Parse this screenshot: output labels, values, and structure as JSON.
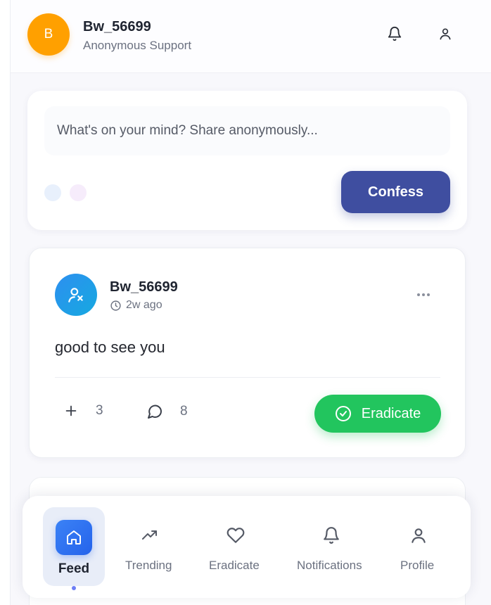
{
  "header": {
    "avatar_initial": "B",
    "username": "Bw_56699",
    "subtitle": "Anonymous Support",
    "icons": [
      "bell-icon",
      "user-icon"
    ]
  },
  "compose": {
    "placeholder": "What's on your mind? Share anonymously...",
    "submit_label": "Confess"
  },
  "posts": [
    {
      "author": "Bw_56699",
      "time": "2w ago",
      "text": "good to see you",
      "support_count": "3",
      "comment_count": "8",
      "eradicate_label": "Eradicate"
    }
  ],
  "nav": {
    "items": [
      {
        "label": "Feed",
        "icon": "home-icon",
        "active": true
      },
      {
        "label": "Trending",
        "icon": "trending-up-icon"
      },
      {
        "label": "Eradicate",
        "icon": "heart-icon"
      },
      {
        "label": "Notifications",
        "icon": "bell-icon"
      },
      {
        "label": "Profile",
        "icon": "user-icon"
      }
    ]
  },
  "colors": {
    "avatar": "#ffa000",
    "confess": "#3f4ea0",
    "eradicate": "#22c55e",
    "feed_active": "#2563eb"
  }
}
